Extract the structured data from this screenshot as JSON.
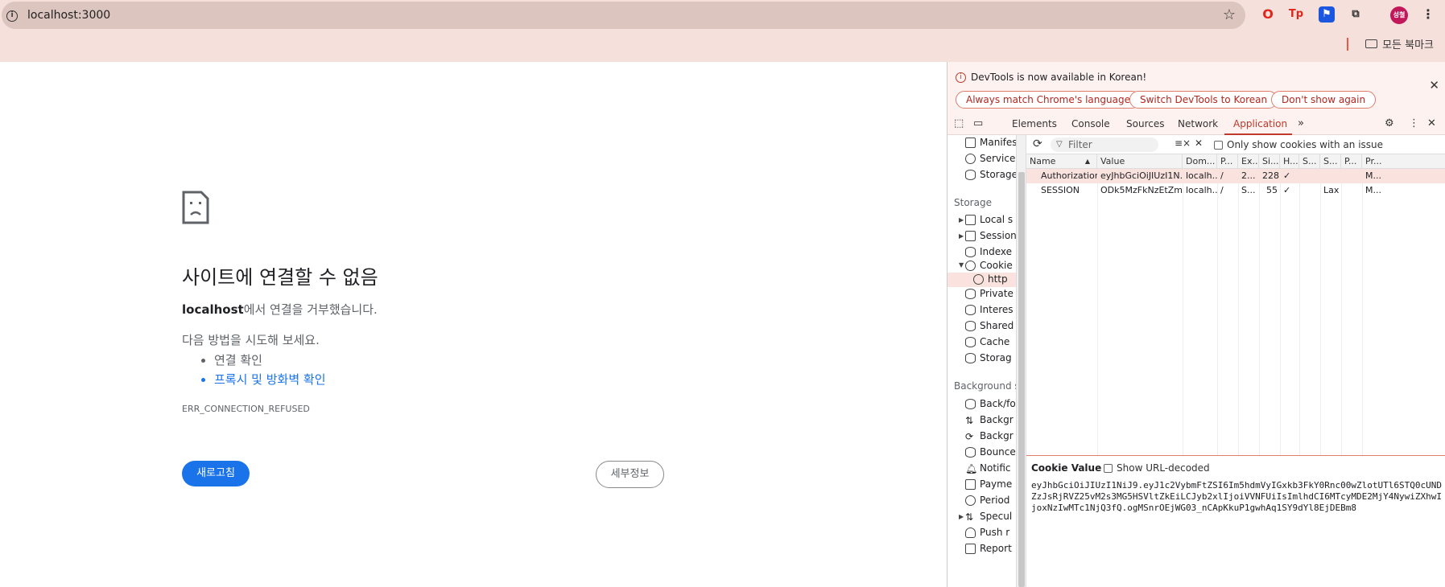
{
  "browser": {
    "url": "localhost:3000",
    "bookmarks_label": "모든 북마크",
    "profile_initials": "성철"
  },
  "error_page": {
    "title": "사이트에 연결할 수 없음",
    "host": "localhost",
    "refused_suffix": "에서 연결을 거부했습니다.",
    "try_heading": "다음 방법을 시도해 보세요.",
    "suggestions": [
      "연결 확인",
      "프록시 및 방화벽 확인"
    ],
    "error_code": "ERR_CONNECTION_REFUSED",
    "reload_label": "새로고침",
    "details_label": "세부정보"
  },
  "devtools": {
    "notice": {
      "message": "DevTools is now available in Korean!",
      "btn_match": "Always match Chrome's language",
      "btn_switch": "Switch DevTools to Korean",
      "btn_dont": "Don't show again"
    },
    "tabs": [
      "Elements",
      "Console",
      "Sources",
      "Network",
      "Application"
    ],
    "active_tab": "Application",
    "sidebar": {
      "top_items": [
        "Manifest",
        "Service",
        "Storage"
      ],
      "storage_heading": "Storage",
      "storage_items": [
        "Local s",
        "Session",
        "Indexe",
        "Cookie",
        "http",
        "Private",
        "Interes",
        "Shared",
        "Cache",
        "Storag"
      ],
      "bg_heading": "Background s",
      "bg_items": [
        "Back/fo",
        "Backgr",
        "Backgr",
        "Bounce",
        "Notific",
        "Payme",
        "Period",
        "Specul",
        "Push r",
        "Report"
      ]
    },
    "cookies": {
      "filter_placeholder": "Filter",
      "only_issue_label": "Only show cookies with an issue",
      "columns": [
        "Name",
        "Value",
        "Dom...",
        "P...",
        "Ex...",
        "Si...",
        "H...",
        "S...",
        "S...",
        "P...",
        "Pr..."
      ],
      "rows": [
        [
          "Authorization",
          "eyJhbGciOiJIUzI1N...",
          "localh...",
          "/",
          "2...",
          "228",
          "✓",
          "",
          "",
          "",
          "M..."
        ],
        [
          "SESSION",
          "ODk5MzFkNzEtZm...",
          "localh...",
          "/",
          "S...",
          "55",
          "✓",
          "",
          "Lax",
          "",
          "M..."
        ]
      ],
      "cookie_value_label": "Cookie Value",
      "show_decoded_label": "Show URL-decoded",
      "cookie_value": "eyJhbGciOiJIUzI1NiJ9.eyJ1c2VybmFtZSI6Im5hdmVyIGxkb3FkY0Rnc00wZlotUTl6STQ0cUNDZzJsRjRVZ25vM2s3MG5HSVltZkEiLCJyb2xlIjoiVVNFUiIsImlhdCI6MTcyMDE2MjY4NywiZXhwIjoxNzIwMTc1NjQ3fQ.ogMSnrOEjWG03_nCApKkuP1gwhAq1SY9dYl8EjDEBm8"
    }
  }
}
